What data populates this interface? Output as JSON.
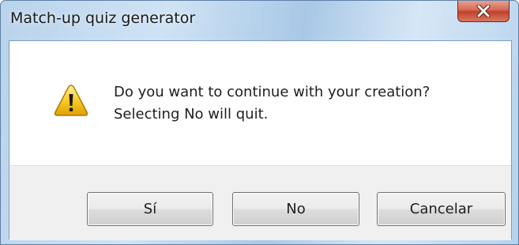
{
  "window": {
    "title": "Match-up quiz generator",
    "close_icon": "close-icon"
  },
  "dialog": {
    "icon": "warning-icon",
    "message_line1": "Do you want to continue with your creation?",
    "message_line2": "Selecting No will quit."
  },
  "buttons": {
    "yes_label": "Sí",
    "no_label": "No",
    "cancel_label": "Cancelar"
  },
  "colors": {
    "frame": "#b9d3ec",
    "close_button": "#c2412c",
    "warning_fill": "#f5c518",
    "button_area": "#f0f0f0"
  }
}
